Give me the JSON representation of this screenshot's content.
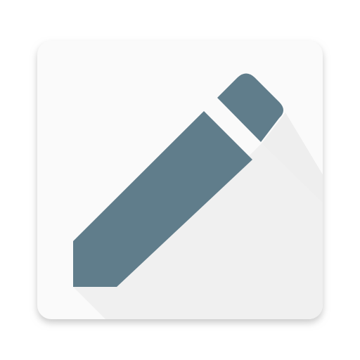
{
  "icon": {
    "name": "pencil-edit-app-icon",
    "tile_color": "#fafafa",
    "pencil_color": "#607d8b",
    "long_shadow_color": "#f0f0f0",
    "tile_shadow_color": "#bdbdbd"
  }
}
